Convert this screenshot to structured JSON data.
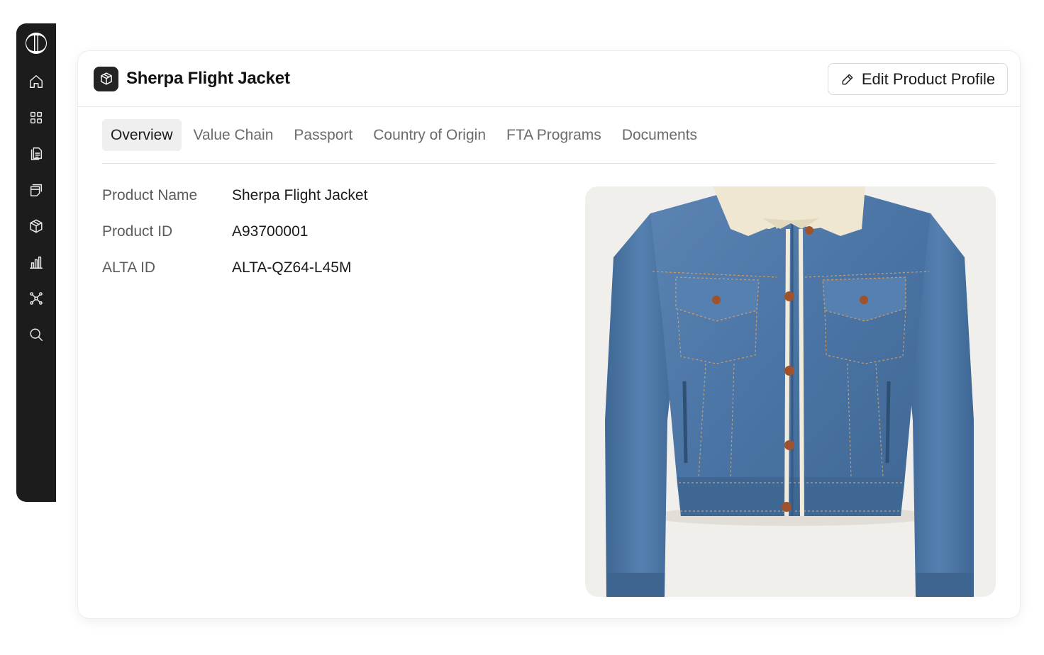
{
  "sidebar": {
    "logo": "brand-logo",
    "items": [
      {
        "icon": "home-icon"
      },
      {
        "icon": "grid-icon"
      },
      {
        "icon": "documents-icon"
      },
      {
        "icon": "copy-icon"
      },
      {
        "icon": "package-icon"
      },
      {
        "icon": "bar-chart-icon"
      },
      {
        "icon": "network-icon"
      },
      {
        "icon": "search-icon"
      }
    ]
  },
  "header": {
    "icon": "package-icon",
    "title": "Sherpa Flight Jacket",
    "edit_button": "Edit Product Profile",
    "edit_icon": "pencil-icon"
  },
  "tabs": [
    {
      "label": "Overview",
      "active": true
    },
    {
      "label": "Value Chain",
      "active": false
    },
    {
      "label": "Passport",
      "active": false
    },
    {
      "label": "Country of Origin",
      "active": false
    },
    {
      "label": "FTA Programs",
      "active": false
    },
    {
      "label": "Documents",
      "active": false
    }
  ],
  "details": [
    {
      "label": "Product Name",
      "value": "Sherpa Flight Jacket"
    },
    {
      "label": "Product ID",
      "value": "A93700001"
    },
    {
      "label": "ALTA ID",
      "value": "ALTA-QZ64-L45M"
    }
  ],
  "image": {
    "subject": "denim jacket with sherpa collar",
    "denim_color": "#4a74a4",
    "collar_color": "#efe7d2",
    "background_color": "#f1efeb"
  }
}
